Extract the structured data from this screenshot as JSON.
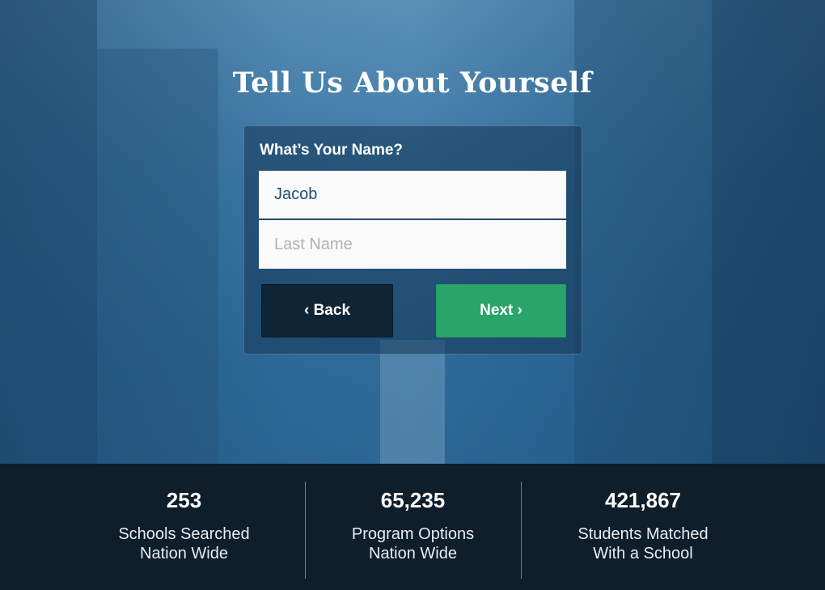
{
  "page": {
    "title": "Tell Us About Yourself"
  },
  "form": {
    "label": "What’s Your Name?",
    "first_name_value": "Jacob",
    "last_name_placeholder": "Last Name",
    "back_label": "‹ Back",
    "next_label": "Next ›"
  },
  "stats": [
    {
      "number": "253",
      "line1": "Schools Searched",
      "line2": "Nation Wide"
    },
    {
      "number": "65,235",
      "line1": "Program Options",
      "line2": "Nation Wide"
    },
    {
      "number": "421,867",
      "line1": "Students Matched",
      "line2": "With a School"
    }
  ],
  "colors": {
    "next_button": "#2aa56a",
    "back_button": "#0f2536",
    "stats_bar": "#0e1e2b",
    "input_text": "#1f4d73"
  }
}
